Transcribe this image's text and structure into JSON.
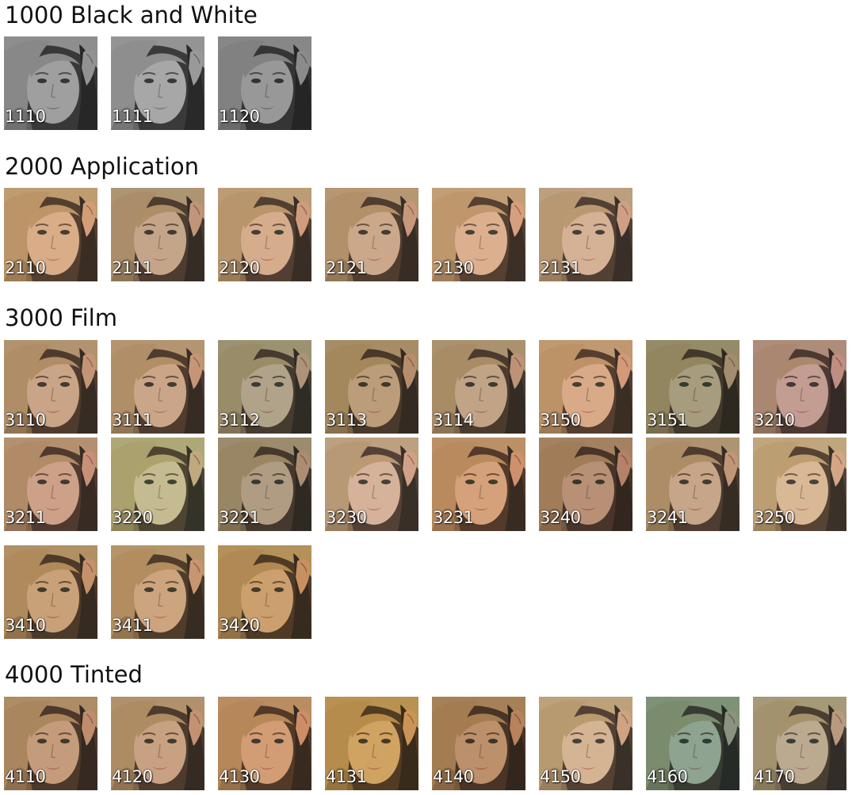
{
  "sections": [
    {
      "title": "1000 Black and White",
      "presets": [
        {
          "code": "1110",
          "tint": "#8a8a8a"
        },
        {
          "code": "1111",
          "tint": "#9a9a9a"
        },
        {
          "code": "1120",
          "tint": "#7a7a7a"
        }
      ]
    },
    {
      "title": "2000 Application",
      "presets": [
        {
          "code": "2110",
          "tint": "#e0b88a"
        },
        {
          "code": "2111",
          "tint": "#b9a58e"
        },
        {
          "code": "2120",
          "tint": "#d9b898"
        },
        {
          "code": "2121",
          "tint": "#c8ab92"
        },
        {
          "code": "2130",
          "tint": "#e7bd9e"
        },
        {
          "code": "2131",
          "tint": "#d8c0b0"
        }
      ]
    },
    {
      "title": "3000 Film",
      "presets": [
        {
          "code": "3110",
          "tint": "#c2a186"
        },
        {
          "code": "3111",
          "tint": "#c6a58a"
        },
        {
          "code": "3112",
          "tint": "#8fa08e"
        },
        {
          "code": "3113",
          "tint": "#a89368"
        },
        {
          "code": "3114",
          "tint": "#b1a086"
        },
        {
          "code": "3150",
          "tint": "#e2b08a"
        },
        {
          "code": "3151",
          "tint": "#7d8f6e"
        },
        {
          "code": "3210",
          "tint": "#b693a6"
        },
        {
          "code": "3211",
          "tint": "#c99a8a"
        },
        {
          "code": "3220",
          "tint": "#b9d7a0"
        },
        {
          "code": "3221",
          "tint": "#8f8f80"
        },
        {
          "code": "3230",
          "tint": "#d9c2b8"
        },
        {
          "code": "3231",
          "tint": "#d99a6a"
        },
        {
          "code": "3240",
          "tint": "#a0745a"
        },
        {
          "code": "3241",
          "tint": "#bca48c"
        },
        {
          "code": "3250",
          "tint": "#e2d0b0"
        },
        {
          "code": "3410",
          "tint": "#c19a62"
        },
        {
          "code": "3411",
          "tint": "#c8a470"
        },
        {
          "code": "3420",
          "tint": "#c69848"
        }
      ]
    },
    {
      "title": "4000 Tinted",
      "presets": [
        {
          "code": "4110",
          "tint": "#b8906a"
        },
        {
          "code": "4120",
          "tint": "#c09c7c"
        },
        {
          "code": "4130",
          "tint": "#d49458"
        },
        {
          "code": "4131",
          "tint": "#d2a02a"
        },
        {
          "code": "4140",
          "tint": "#a87440"
        },
        {
          "code": "4150",
          "tint": "#d8c6aa"
        },
        {
          "code": "4160",
          "tint": "#4aa0a0"
        },
        {
          "code": "4170",
          "tint": "#a8b0a0"
        }
      ]
    }
  ]
}
